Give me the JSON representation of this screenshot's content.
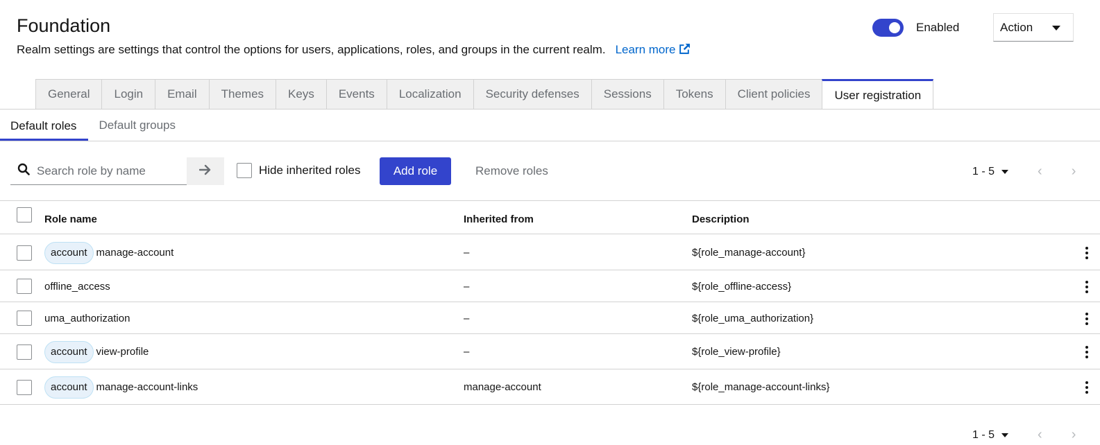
{
  "header": {
    "title": "Foundation",
    "description": "Realm settings are settings that control the options for users, applications, roles, and groups in the current realm.",
    "learn_more": "Learn more",
    "enabled_label": "Enabled",
    "enabled": true,
    "action_label": "Action"
  },
  "tabs": [
    {
      "label": "General"
    },
    {
      "label": "Login"
    },
    {
      "label": "Email"
    },
    {
      "label": "Themes"
    },
    {
      "label": "Keys"
    },
    {
      "label": "Events"
    },
    {
      "label": "Localization"
    },
    {
      "label": "Security defenses"
    },
    {
      "label": "Sessions"
    },
    {
      "label": "Tokens"
    },
    {
      "label": "Client policies"
    },
    {
      "label": "User registration",
      "active": true
    }
  ],
  "subtabs": [
    {
      "label": "Default roles",
      "active": true
    },
    {
      "label": "Default groups"
    }
  ],
  "toolbar": {
    "search_placeholder": "Search role by name",
    "hide_inherited_label": "Hide inherited roles",
    "add_role_label": "Add role",
    "remove_roles_label": "Remove roles",
    "pagination": "1 - 5"
  },
  "table": {
    "columns": [
      "Role name",
      "Inherited from",
      "Description"
    ],
    "rows": [
      {
        "chip": "account",
        "name": "manage-account",
        "inherited": "–",
        "description": "${role_manage-account}"
      },
      {
        "chip": "",
        "name": "offline_access",
        "inherited": "–",
        "description": "${role_offline-access}"
      },
      {
        "chip": "",
        "name": "uma_authorization",
        "inherited": "–",
        "description": "${role_uma_authorization}"
      },
      {
        "chip": "account",
        "name": "view-profile",
        "inherited": "–",
        "description": "${role_view-profile}"
      },
      {
        "chip": "account",
        "name": "manage-account-links",
        "inherited": "manage-account",
        "description": "${role_manage-account-links}"
      }
    ]
  },
  "footer": {
    "pagination": "1 - 5"
  },
  "colors": {
    "primary": "#3344cc",
    "link": "#0066cc",
    "chip_bg": "#e7f1fa",
    "chip_border": "#bee1f4"
  }
}
